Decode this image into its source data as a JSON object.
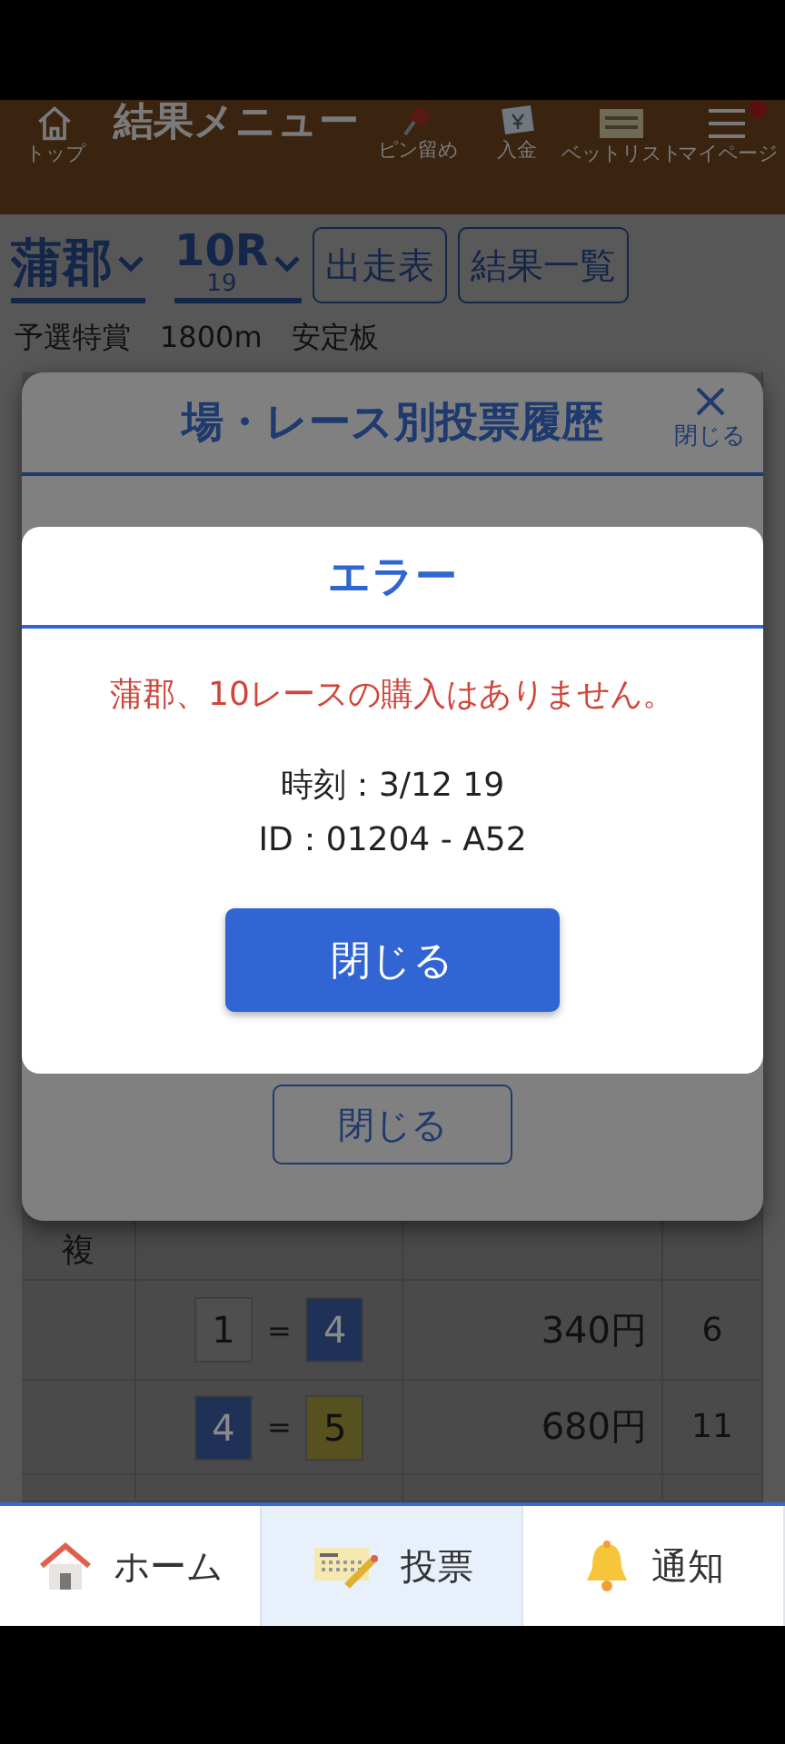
{
  "header": {
    "title": "結果メニュー",
    "items": [
      {
        "kind": "home",
        "label": "トップ",
        "badge": false
      },
      {
        "kind": "pin",
        "label": "ピン留め",
        "badge": false
      },
      {
        "kind": "deposit",
        "label": "入金",
        "badge": false
      },
      {
        "kind": "betlist",
        "label": "ベットリスト",
        "badge": false
      },
      {
        "kind": "menu",
        "label": "マイページ",
        "badge": true
      }
    ]
  },
  "race_bar": {
    "venue": "蒲郡",
    "race": "10R",
    "race_time": "19",
    "buttons": [
      "出走表",
      "結果一覧"
    ]
  },
  "race_info": "予選特賞　1800m　安定板",
  "history_modal": {
    "title": "場・レース別投票履歴",
    "close_label": "閉じる",
    "close_button": "閉じる"
  },
  "results_table": {
    "bet_type": "複",
    "rows": [
      {
        "boats": [
          {
            "number": "1",
            "color": "#4f4f4f"
          },
          {
            "number": "4",
            "color": "#1f3156"
          }
        ],
        "joiner": "=",
        "payout": "340円",
        "popularity": "6"
      },
      {
        "boats": [
          {
            "number": "4",
            "color": "#1f3156"
          },
          {
            "number": "5",
            "color": "#57511f"
          }
        ],
        "joiner": "=",
        "payout": "680円",
        "popularity": "11"
      }
    ]
  },
  "error_dialog": {
    "title": "エラー",
    "message": "蒲郡、10レースの購入はありません。",
    "time": "時刻：3/12 19",
    "id": "ID：01204 - A52",
    "button": "閉じる"
  },
  "bottom_nav": [
    {
      "kind": "home",
      "label": "ホーム",
      "selected": false
    },
    {
      "kind": "vote",
      "label": "投票",
      "selected": true
    },
    {
      "kind": "bell",
      "label": "通知",
      "selected": false
    }
  ]
}
